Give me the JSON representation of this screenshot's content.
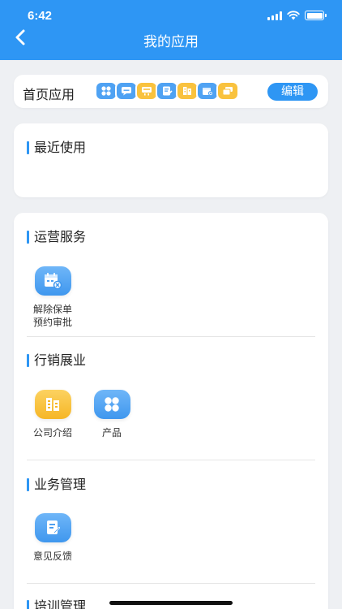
{
  "status_bar": {
    "time": "6:42"
  },
  "header": {
    "title": "我的应用"
  },
  "home_apps": {
    "label": "首页应用",
    "edit_label": "编辑",
    "icons": [
      {
        "name": "grid-icon",
        "color": "#4fa2f3"
      },
      {
        "name": "chat-icon",
        "color": "#4fa2f3"
      },
      {
        "name": "screen-icon",
        "color": "#f9c23e"
      },
      {
        "name": "document-edit-icon",
        "color": "#4fa2f3"
      },
      {
        "name": "building-icon",
        "color": "#f9c23e"
      },
      {
        "name": "calendar-cancel-icon",
        "color": "#4fa2f3"
      },
      {
        "name": "cards-icon",
        "color": "#f9c23e"
      }
    ]
  },
  "recent": {
    "title": "最近使用"
  },
  "sections": [
    {
      "title": "运营服务",
      "apps": [
        {
          "label_line1": "解除保单",
          "label_line2": "预约审批",
          "icon": "calendar-cancel-icon",
          "color": "#3f97ee"
        }
      ]
    },
    {
      "title": "行销展业",
      "apps": [
        {
          "label": "公司介绍",
          "icon": "building-icon",
          "color": "#f6b626"
        },
        {
          "label": "产品",
          "icon": "grid-icon",
          "color": "#3f97ee"
        }
      ]
    },
    {
      "title": "业务管理",
      "apps": [
        {
          "label": "意见反馈",
          "icon": "document-edit-icon",
          "color": "#3f97ee"
        }
      ]
    },
    {
      "title": "培训管理",
      "apps": []
    }
  ],
  "colors": {
    "primary": "#2e96f4",
    "accent_yellow": "#f9c23e",
    "background": "#eef0f3"
  }
}
